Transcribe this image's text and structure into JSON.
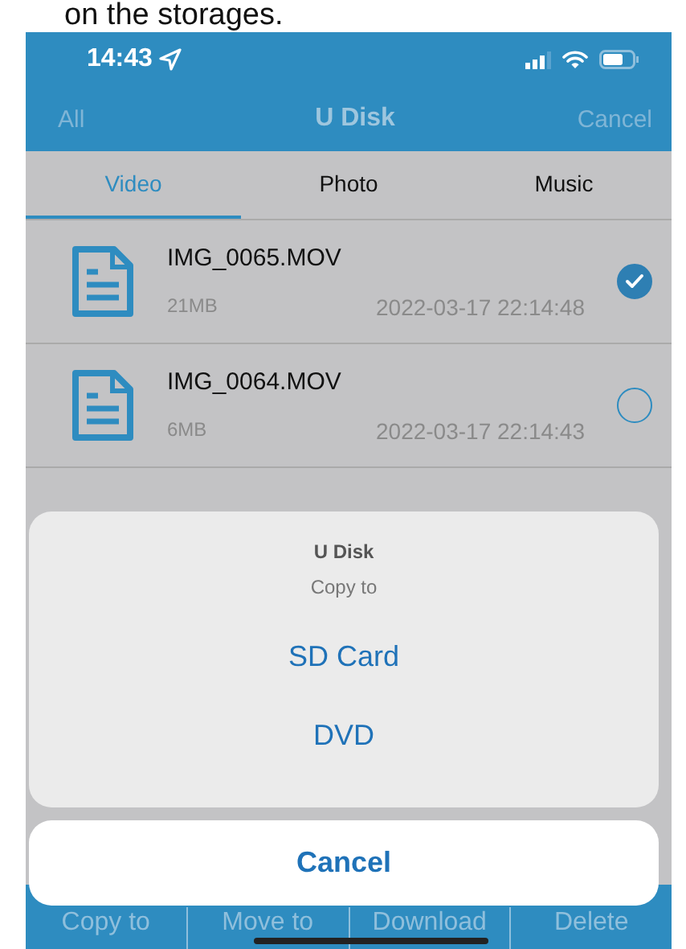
{
  "caption": "on the storages.",
  "status_bar": {
    "time": "14:43"
  },
  "nav": {
    "left": "All",
    "title": "U Disk",
    "right": "Cancel"
  },
  "tabs": [
    {
      "label": "Video",
      "selected": true
    },
    {
      "label": "Photo",
      "selected": false
    },
    {
      "label": "Music",
      "selected": false
    }
  ],
  "files": [
    {
      "name": "IMG_0065.MOV",
      "size": "21MB",
      "date": "2022-03-17 22:14:48",
      "selected": true
    },
    {
      "name": "IMG_0064.MOV",
      "size": "6MB",
      "date": "2022-03-17 22:14:43",
      "selected": false
    }
  ],
  "toolbar": [
    "Copy to",
    "Move to",
    "Download",
    "Delete"
  ],
  "action_sheet": {
    "title": "U Disk",
    "message": "Copy to",
    "options": [
      "SD Card",
      "DVD"
    ],
    "cancel": "Cancel"
  }
}
